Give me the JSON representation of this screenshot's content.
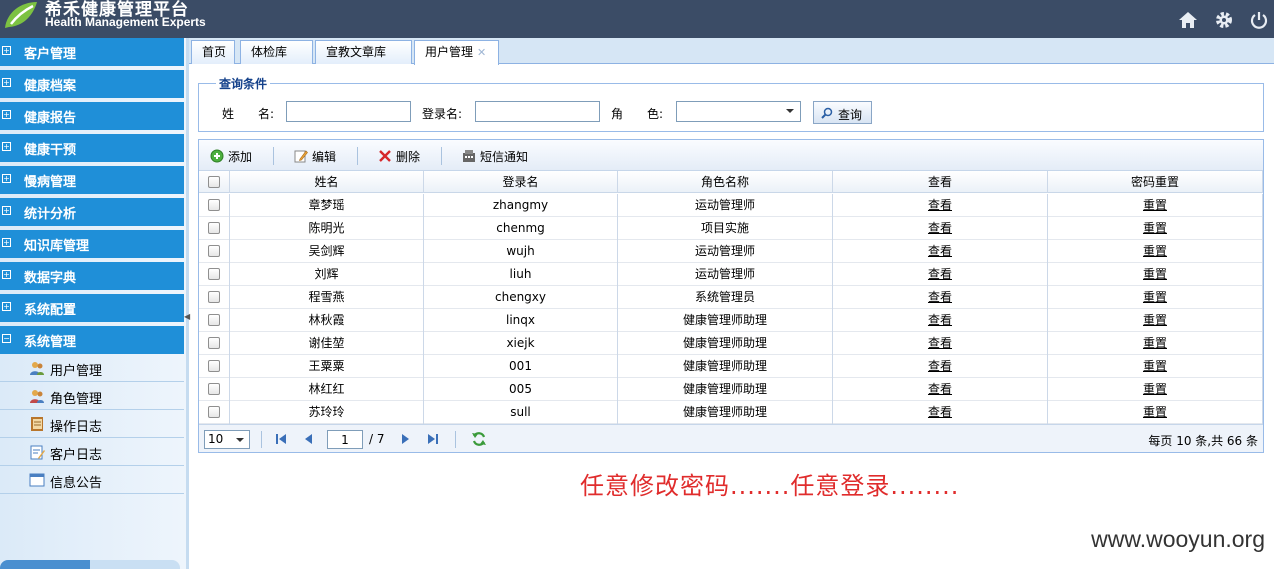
{
  "header": {
    "logo_cn": "希禾健康管理平台",
    "logo_en": "Health Management Experts",
    "icons": [
      "home-icon",
      "gear-icon",
      "power-icon"
    ]
  },
  "sidebar": {
    "menus": [
      {
        "label": "客户管理"
      },
      {
        "label": "健康档案"
      },
      {
        "label": "健康报告"
      },
      {
        "label": "健康干预"
      },
      {
        "label": "慢病管理"
      },
      {
        "label": "统计分析"
      },
      {
        "label": "知识库管理"
      },
      {
        "label": "数据字典"
      },
      {
        "label": "系统配置"
      },
      {
        "label": "系统管理"
      }
    ],
    "submenu": [
      {
        "label": "用户管理",
        "icon": "users-icon"
      },
      {
        "label": "角色管理",
        "icon": "role-icon"
      },
      {
        "label": "操作日志",
        "icon": "log-book-icon"
      },
      {
        "label": "客户日志",
        "icon": "edit-log-icon"
      },
      {
        "label": "信息公告",
        "icon": "window-icon"
      }
    ]
  },
  "tabs": [
    {
      "label": "首页"
    },
    {
      "label": "体检库"
    },
    {
      "label": "宣教文章库"
    },
    {
      "label": "用户管理",
      "close": "✕"
    }
  ],
  "query": {
    "legend": "查询条件",
    "name_label": "姓　　名:",
    "login_label": "登录名:",
    "role_label": "角　　色:",
    "name_value": "",
    "login_value": "",
    "role_value": "",
    "search_label": "查询"
  },
  "toolbar": {
    "add": "添加",
    "edit": "编辑",
    "delete": "删除",
    "sms": "短信通知"
  },
  "table": {
    "columns": [
      "姓名",
      "登录名",
      "角色名称",
      "查看",
      "密码重置"
    ],
    "rows": [
      {
        "name": "章梦瑶",
        "login": "zhangmy",
        "role": "运动管理师",
        "view": "查看",
        "reset": "重置"
      },
      {
        "name": "陈明光",
        "login": "chenmg",
        "role": "项目实施",
        "view": "查看",
        "reset": "重置"
      },
      {
        "name": "吴剑辉",
        "login": "wujh",
        "role": "运动管理师",
        "view": "查看",
        "reset": "重置"
      },
      {
        "name": "刘辉",
        "login": "liuh",
        "role": "运动管理师",
        "view": "查看",
        "reset": "重置"
      },
      {
        "name": "程雪燕",
        "login": "chengxy",
        "role": "系统管理员",
        "view": "查看",
        "reset": "重置"
      },
      {
        "name": "林秋霞",
        "login": "linqx",
        "role": "健康管理师助理",
        "view": "查看",
        "reset": "重置"
      },
      {
        "name": "谢佳堃",
        "login": "xiejk",
        "role": "健康管理师助理",
        "view": "查看",
        "reset": "重置"
      },
      {
        "name": "王粟粟",
        "login": "001",
        "role": "健康管理师助理",
        "view": "查看",
        "reset": "重置"
      },
      {
        "name": "林红红",
        "login": "005",
        "role": "健康管理师助理",
        "view": "查看",
        "reset": "重置"
      },
      {
        "name": "苏玲玲",
        "login": "sull",
        "role": "健康管理师助理",
        "view": "查看",
        "reset": "重置"
      }
    ]
  },
  "pager": {
    "page_size": "10",
    "current_page": "1",
    "total_pages": "/ 7",
    "info": "每页 10 条,共 66 条"
  },
  "annotation": "任意修改密码.......任意登录........",
  "watermark": "www.wooyun.org",
  "colors": {
    "header_bg": "#3b4c66",
    "menu_bg": "#1f8fd8",
    "annotation": "#e02c2c",
    "legend": "#15428b"
  }
}
